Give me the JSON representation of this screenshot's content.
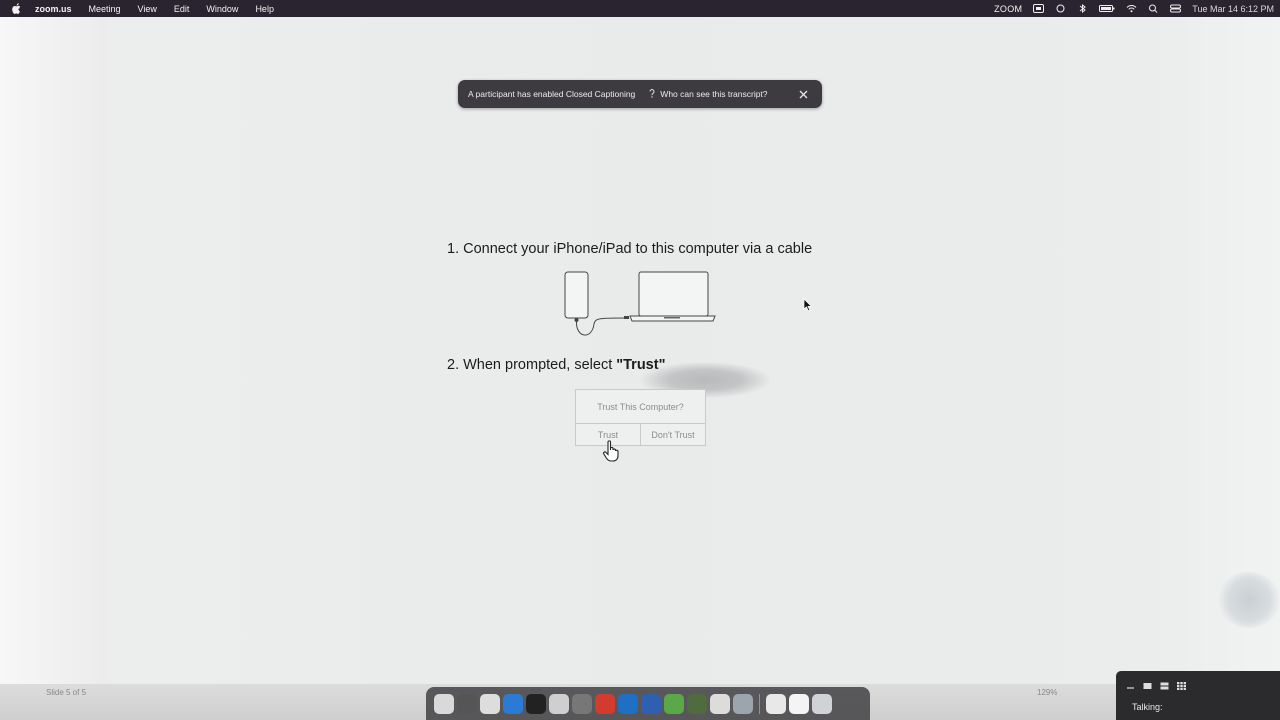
{
  "menubar": {
    "app_name": "zoom.us",
    "menus": [
      "Meeting",
      "View",
      "Edit",
      "Window",
      "Help"
    ],
    "status_zoom": "ZOOM",
    "clock": "Tue Mar 14  6:12 PM"
  },
  "caption_banner": {
    "message": "A participant has enabled Closed Captioning",
    "link": "Who can see this transcript?"
  },
  "slide": {
    "step1": "1.  Connect your iPhone/iPad to this computer via a cable",
    "step2_prefix": "2.  When prompted, select ",
    "step2_bold": "\"Trust\"",
    "dialog": {
      "question": "Trust This Computer?",
      "trust": "Trust",
      "dont_trust": "Don't Trust"
    }
  },
  "bottom": {
    "slide_counter": "Slide 5 of 5",
    "zoom_level": "129%"
  },
  "dock": {
    "icons": [
      "finder-icon",
      "launchpad-icon",
      "chrome-icon",
      "vscode-icon",
      "terminal-icon",
      "preview-icon",
      "calculator-icon",
      "acrobat-icon",
      "outlook-icon",
      "word-icon",
      "vim-icon",
      "klokki-icon",
      "keychain-icon",
      "quicktime-icon",
      "documents-icon",
      "desktop-icon",
      "trash-icon"
    ],
    "colors": [
      "#d9d9d9",
      "#555555",
      "#dddddd",
      "#2b7bd6",
      "#222222",
      "#cfcfcf",
      "#777777",
      "#d23b2e",
      "#1f6fc2",
      "#2f5fb0",
      "#5aa84a",
      "#4f6b3f",
      "#dcdcdc",
      "#9aa5ad",
      "#e8e8e8",
      "#f4f4f4",
      "#cfd3d6"
    ]
  },
  "talking_panel": {
    "label": "Talking:"
  },
  "colors": {
    "menubar": "#2a2430",
    "banner": "#3d3b40",
    "background": "#e9ebeb"
  }
}
